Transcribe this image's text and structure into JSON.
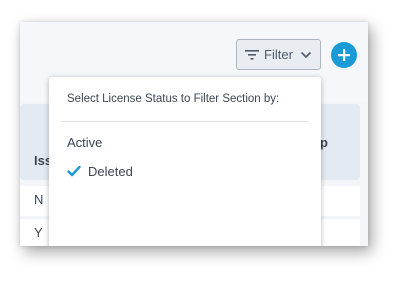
{
  "toolbar": {
    "filter_label": "Filter",
    "filter_icon": "filter-lines-icon",
    "chevron_icon": "chevron-down-icon",
    "add_icon": "plus-icon",
    "accent_color": "#1a9bd7"
  },
  "table": {
    "headers": [
      "Iss",
      "p"
    ],
    "rows": [
      {
        "value": "N"
      },
      {
        "value": "Y"
      }
    ]
  },
  "dropdown": {
    "title": "Select License Status to Filter Section by:",
    "options": [
      {
        "label": "Active",
        "selected": false
      },
      {
        "label": "Deleted",
        "selected": true
      }
    ],
    "check_icon": "check-icon",
    "check_color": "#1a9bd7"
  }
}
